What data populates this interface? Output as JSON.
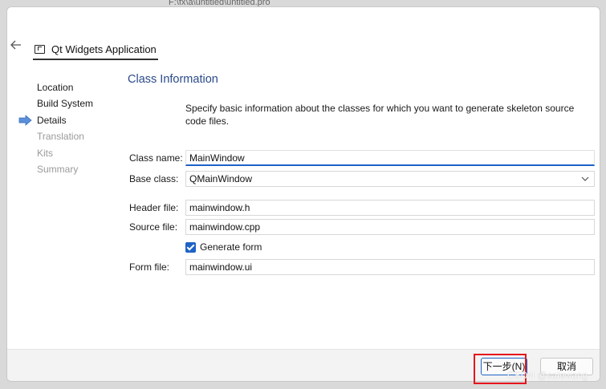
{
  "background_path": "F:\\fx\\a\\untitled\\untitled.pro",
  "window": {
    "title": "Qt Widgets Application",
    "back_icon": "arrow-left-icon",
    "title_icon": "window-icon"
  },
  "steps": [
    {
      "label": "Location",
      "state": "done"
    },
    {
      "label": "Build System",
      "state": "done"
    },
    {
      "label": "Details",
      "state": "current"
    },
    {
      "label": "Translation",
      "state": "disabled"
    },
    {
      "label": "Kits",
      "state": "disabled"
    },
    {
      "label": "Summary",
      "state": "disabled"
    }
  ],
  "content": {
    "title": "Class Information",
    "description": "Specify basic information about the classes for which you want to generate skeleton source code files.",
    "class_name": {
      "label": "Class name:",
      "value": "MainWindow"
    },
    "base_class": {
      "label": "Base class:",
      "value": "QMainWindow"
    },
    "header_file": {
      "label": "Header file:",
      "value": "mainwindow.h"
    },
    "source_file": {
      "label": "Source file:",
      "value": "mainwindow.cpp"
    },
    "generate_form": {
      "label": "Generate form",
      "checked": true
    },
    "form_file": {
      "label": "Form file:",
      "value": "mainwindow.ui"
    }
  },
  "footer": {
    "next_label": "下一步(N)",
    "cancel_label": "取消"
  },
  "watermark": "CSDN @salewang",
  "colors": {
    "accent": "#1e63c5",
    "title_blue": "#2a4a8a",
    "highlight_red": "#e5151c"
  }
}
